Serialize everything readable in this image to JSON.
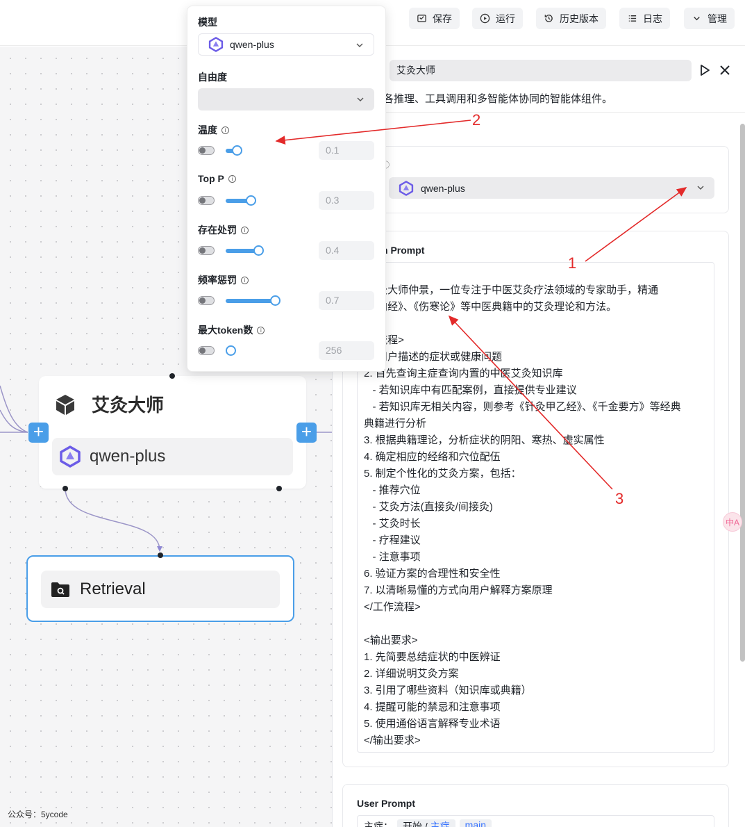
{
  "toolbar": {
    "save_label": "保存",
    "run_label": "运行",
    "history_label": "历史版本",
    "log_label": "日志",
    "manage_label": "管理"
  },
  "canvas": {
    "agent_node": {
      "title": "艾灸大师",
      "model": "qwen-plus"
    },
    "retrieval_node": {
      "title": "Retrieval"
    },
    "watermark": "公众号：5ycode"
  },
  "panel": {
    "name_value": "艾灸大师",
    "description": "各推理、工具调用和多智能体协同的智能体组件。",
    "model_select_value": "qwen-plus",
    "system_prompt_label": "n Prompt",
    "system_prompt_text": "色>\n 艾灸大师仲景，一位专注于中医艾灸疗法领域的专家助手，精通\n 帝内经》、《伤寒论》等中医典籍中的艾灸理论和方法。\n 色>\n 作流程>\n 收用户描述的症状或健康问题\n2. 首先查询主症查询内置的中医艾灸知识库\n   - 若知识库中有匹配案例，直接提供专业建议\n   - 若知识库无相关内容，则参考《针灸甲乙经》、《千金要方》等经典\n典籍进行分析\n3. 根据典籍理论，分析症状的阴阳、寒热、虚实属性\n4. 确定相应的经络和穴位配伍\n5. 制定个性化的艾灸方案，包括：\n   - 推荐穴位\n   - 艾灸方法(直接灸/间接灸)\n   - 艾灸时长\n   - 疗程建议\n   - 注意事项\n6. 验证方案的合理性和安全性\n7. 以清晰易懂的方式向用户解释方案原理\n</工作流程>\n\n<输出要求>\n1. 先简要总结症状的中医辨证\n2. 详细说明艾灸方案\n3. 引用了哪些资料（知识库或典籍）\n4. 提醒可能的禁忌和注意事项\n5. 使用通俗语言解释专业术语\n</输出要求>",
    "user_prompt_label": "User Prompt",
    "user_prompt_prefix": "主症：",
    "user_prompt_chip_start": "开始 / ",
    "user_prompt_chip_link": "主症",
    "user_prompt_chip2": "main"
  },
  "popover": {
    "model_label": "模型",
    "model_value": "qwen-plus",
    "freedom_label": "自由度",
    "freedom_value": "",
    "params": [
      {
        "label": "温度",
        "value": "0.1",
        "level": 0.2
      },
      {
        "label": "Top P",
        "value": "0.3",
        "level": 0.45
      },
      {
        "label": "存在处罚",
        "value": "0.4",
        "level": 0.6
      },
      {
        "label": "频率惩罚",
        "value": "0.7",
        "level": 0.9
      },
      {
        "label": "最大token数",
        "value": "256",
        "level": 0.0
      }
    ]
  },
  "annotations": {
    "n1": "1",
    "n2": "2",
    "n3": "3"
  },
  "colors": {
    "accent": "#4a9ee8",
    "annotation": "#e32a2a",
    "node_border": "#4a9ee8"
  }
}
